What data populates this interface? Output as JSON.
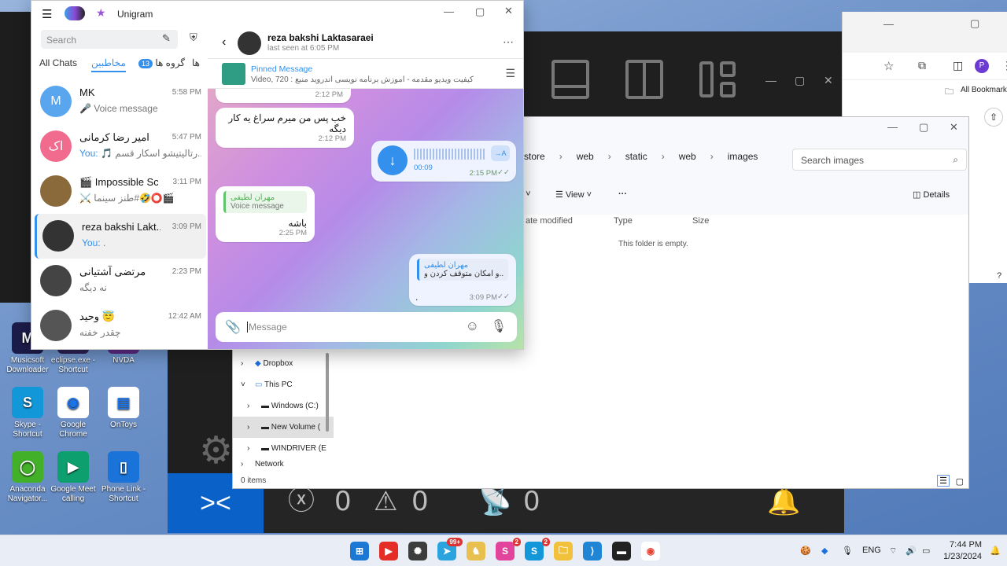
{
  "desktop": {
    "icons": [
      {
        "label": "Musicsoft Downloader",
        "color": "#1c1c4a",
        "glyph": "M"
      },
      {
        "label": "eclipse.exe - Shortcut",
        "color": "#2c2255",
        "glyph": "e"
      },
      {
        "label": "NVDA",
        "color": "#5a2a84",
        "glyph": "N"
      },
      {
        "label": "Skype - Shortcut",
        "color": "#1297d8",
        "glyph": "S"
      },
      {
        "label": "Google Chrome",
        "color": "#ffffff",
        "glyph": "◉"
      },
      {
        "label": "OnToys",
        "color": "#ffffff",
        "glyph": "▤"
      },
      {
        "label": "Anaconda Navigator...",
        "color": "#43b02a",
        "glyph": "◯"
      },
      {
        "label": "Google Meet calling",
        "color": "#0e9f6e",
        "glyph": "▶"
      },
      {
        "label": "Phone Link - Shortcut",
        "color": "#1a73d8",
        "glyph": "▯"
      }
    ]
  },
  "dark_app": {
    "status_errors": "0",
    "status_warnings": "0",
    "status_ports": "0"
  },
  "chrome": {
    "bookmarks_label": "All Bookmark",
    "profile_initial": "P"
  },
  "explorer": {
    "breadcrumb": [
      "store",
      "web",
      "static",
      "web",
      "images"
    ],
    "search_placeholder": "Search images",
    "toolbar": {
      "view_label": "View",
      "details_label": "Details",
      "more_label": "···"
    },
    "columns": {
      "date": "ate modified",
      "type": "Type",
      "size": "Size"
    },
    "empty_text": "This folder is empty.",
    "nav": [
      "Dropbox",
      "This PC",
      "Windows (C:)",
      "New Volume (",
      "WINDRIVER (E",
      "Network"
    ],
    "status": "0 items"
  },
  "telegram": {
    "app_title": "Unigram",
    "search_placeholder": "Search",
    "tabs": {
      "all": "All Chats",
      "contacts": "مخاطبین",
      "groups": "گروه ها",
      "groups_count": "13",
      "more": "ها"
    },
    "chats": [
      {
        "name": "MK",
        "time": "5:58 PM",
        "preview": "🎤 Voice message",
        "you": "",
        "avatar_text": "M",
        "avatar_color": "#5aa6ee"
      },
      {
        "name": "امیر رضا کرمانی",
        "time": "5:47 PM",
        "preview": "🎵 رتالیتیشو اسکار قسم...",
        "you": "You:",
        "avatar_text": "اک",
        "avatar_color": "#f06b8e"
      },
      {
        "name": "🎬 Impossible Sce...",
        "time": "3:11 PM",
        "preview": "⚔️ طنز سینما#🤣⭕️🎬",
        "you": "",
        "avatar_text": "",
        "avatar_color": "#8a6a3a"
      },
      {
        "name": "reza bakshi Lakt...",
        "time": "3:09 PM",
        "preview": ".",
        "you": "You:",
        "avatar_text": "",
        "avatar_color": "#333333"
      },
      {
        "name": "مرتضی آشتیانی",
        "time": "2:23 PM",
        "preview": "نه دیگه",
        "you": "",
        "avatar_text": "",
        "avatar_color": "#444444"
      },
      {
        "name": "وحید 😇",
        "time": "12:42 AM",
        "preview": "چقدر خفنه",
        "you": "",
        "avatar_text": "",
        "avatar_color": "#555555"
      }
    ],
    "conversation": {
      "name": "reza bakshi Laktasaraei",
      "status": "last seen at 6:05 PM",
      "pinned_title": "Pinned Message",
      "pinned_text": "Video, 720 : کیفیت ویدیو  مقدمه - آموزش برنامه نویسی اندروید  منبع",
      "messages": [
        {
          "text": "",
          "time": "2:12 PM"
        },
        {
          "text": "خب پس من میرم سراغ یه کار دیگه",
          "time": "2:12 PM"
        },
        {
          "text": "",
          "duration": "00:09",
          "time": "2:15 PM",
          "badge": "→A"
        },
        {
          "reply_name": "مهران لطیفی",
          "reply_text": "Voice message",
          "text": "باشه",
          "time": "2:25 PM"
        },
        {
          "reply_name": "مهران لطیفی",
          "reply_text": "و امکان متوقف کردن و...",
          "text": ".",
          "time": "3:09 PM"
        }
      ],
      "input_placeholder": "Message"
    }
  },
  "taskbar": {
    "telegram_badge": "99+",
    "badge2": "2",
    "badge3": "2",
    "lang": "ENG",
    "time": "7:44 PM",
    "date": "1/23/2024"
  }
}
